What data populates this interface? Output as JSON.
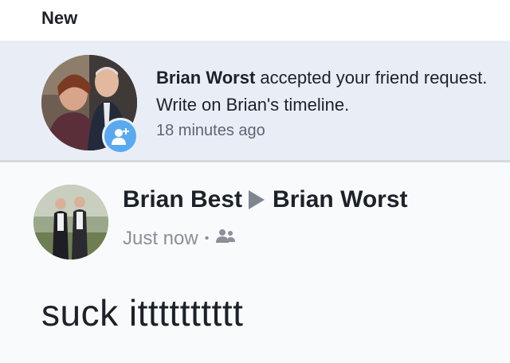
{
  "section": {
    "label": "New"
  },
  "notification": {
    "actor": "Brian Worst",
    "text": "accepted your friend request. Write on Brian's timeline.",
    "time": "18 minutes ago",
    "badge_icon": "add-friend-icon"
  },
  "post": {
    "author": "Brian Best",
    "target": "Brian Worst",
    "time": "Just now",
    "separator": "•",
    "audience_icon": "friends-icon",
    "body": "suck itttttttttt"
  },
  "colors": {
    "badge": "#5aa9f0",
    "notification_bg": "#e9eef6",
    "meta_text": "#8a9099"
  }
}
